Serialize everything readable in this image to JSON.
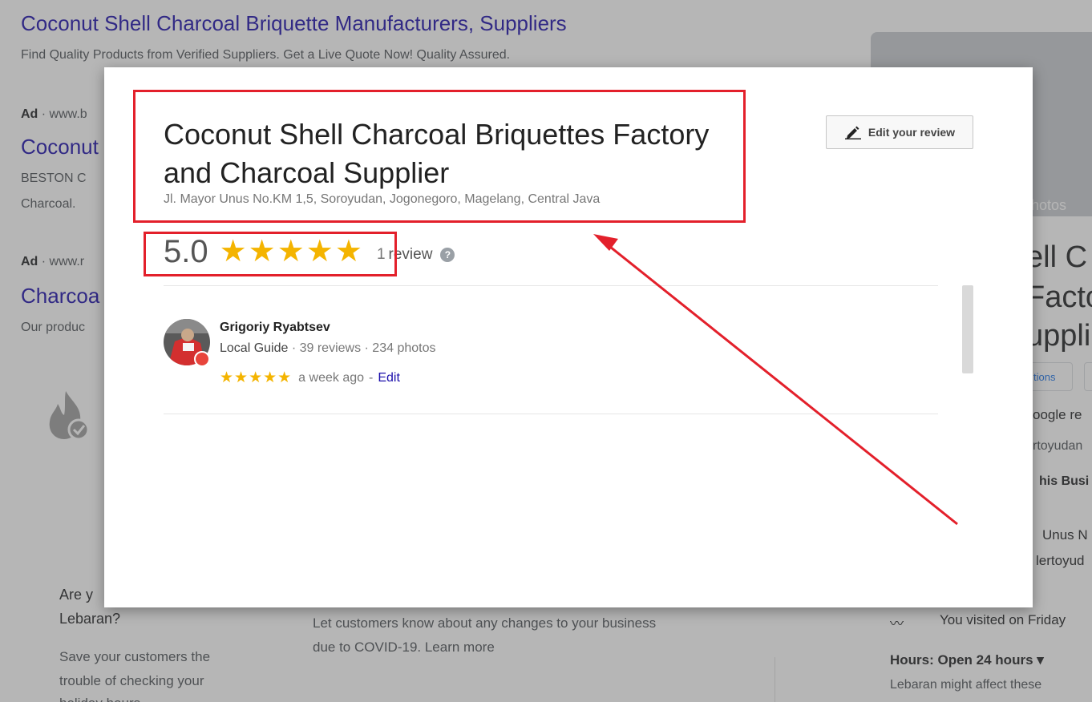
{
  "background": {
    "header_title": "Coconut Shell Charcoal Briquette Manufacturers, Suppliers",
    "header_desc": "Find Quality Products from Verified Suppliers. Get a Live Quote Now! Quality Assured.",
    "ad1_label": "Ad",
    "ad1_url": "· www.b",
    "ad1_title": "Coconut",
    "ad1_line1": "BESTON C",
    "ad1_line2": "Charcoal.",
    "ad2_label": "Ad",
    "ad2_url": "· www.r",
    "ad2_title": "Charcoa",
    "ad2_desc": "Our produc",
    "photos_label": "hotos",
    "kp_title_1": "ell C",
    "kp_title_2": "Facto",
    "kp_title_3": "uppli",
    "chip_label": "tions",
    "kp_line1": "oogle re",
    "kp_line2": "rtoyudan",
    "kp_line3": "his Busi",
    "kp_line4": "Unus N",
    "kp_line5": "lertoyud",
    "visited": "You visited on Friday",
    "hours": "Hours: Open 24 hours ▾",
    "hours_note": "Lebaran might affect these",
    "left_q1": "Are y",
    "left_q2": "Lebaran?",
    "left_p1": "Save your customers the",
    "left_p2": "trouble of checking your",
    "left_p3": "holiday hours",
    "mid_p1": "Let customers know about any changes to your business",
    "mid_p2": "due to COVID-19. Learn more"
  },
  "dialog": {
    "title": "Coconut Shell Charcoal Briquettes Factory and Charcoal Supplier",
    "address": "Jl. Mayor Unus No.KM 1,5, Soroyudan, Jogonegoro, Magelang, Central Java",
    "edit_button_label": "Edit your review",
    "rating": "5.0",
    "stars": "★★★★★",
    "review_count": "1",
    "review_word": "review",
    "help_glyph": "?",
    "review": {
      "author": "Grigoriy Ryabtsev",
      "guide_label": "Local Guide",
      "stats": " · 39 reviews · 234 photos",
      "stars": "★★★★★",
      "time": "a week ago",
      "separator": "-",
      "edit_label": "Edit"
    }
  },
  "annotation_color": "#e3202b",
  "star_color": "#f4b400"
}
